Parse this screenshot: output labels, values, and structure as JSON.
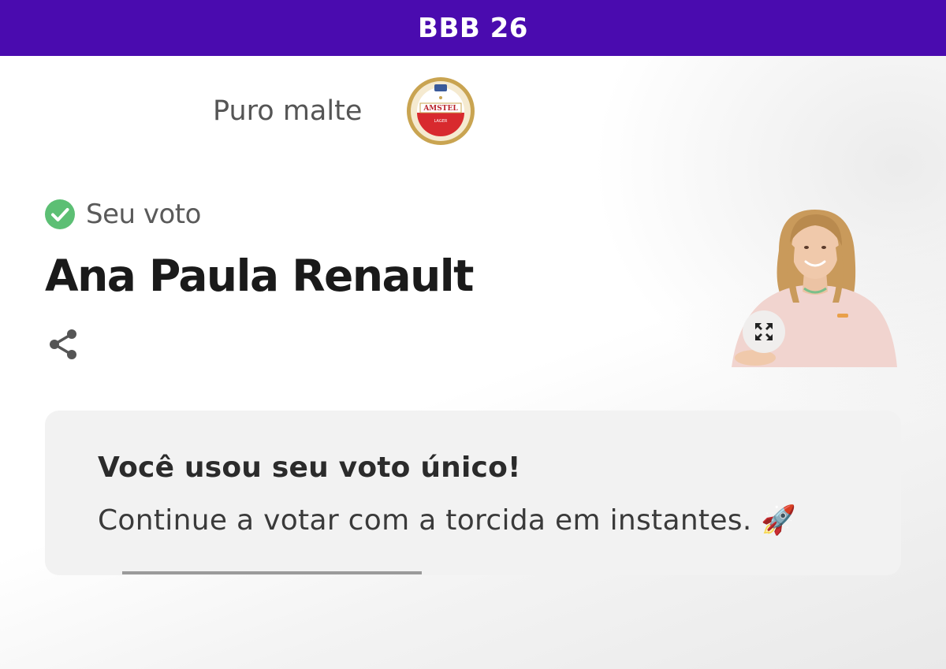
{
  "header": {
    "title": "BBB 26",
    "background_color": "#4a0baf"
  },
  "sponsor": {
    "text": "Puro malte",
    "logo_icon": "amstel-lager-logo"
  },
  "vote": {
    "label": "Seu voto",
    "status_icon": "check-circle-icon",
    "status_color": "#5cbf74",
    "candidate_name": "Ana Paula Renault",
    "share_icon": "share-icon",
    "expand_icon": "expand-icon"
  },
  "notice": {
    "title": "Você usou seu voto único!",
    "message": "Continue a votar com a torcida em instantes. 🚀",
    "progress": 1.0
  }
}
